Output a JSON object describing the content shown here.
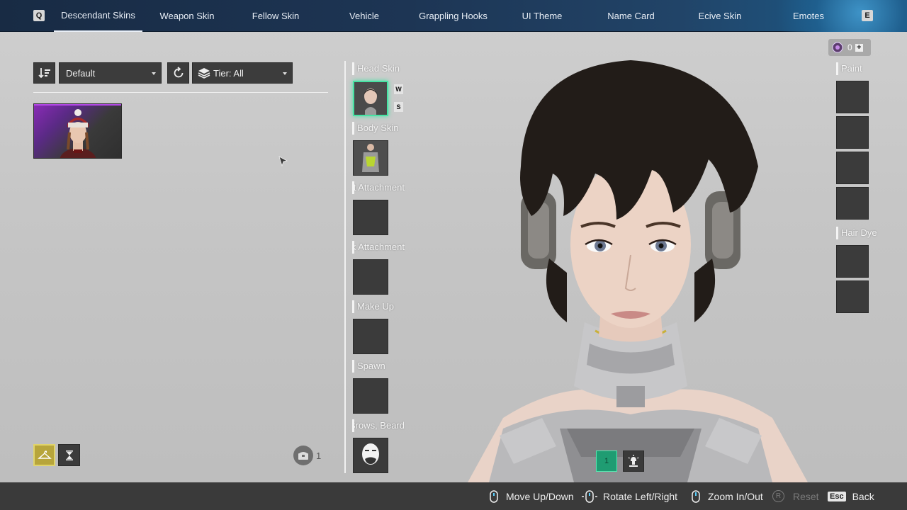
{
  "nav": {
    "left_key": "Q",
    "right_key": "E",
    "tabs": [
      {
        "label": "Descendant Skins",
        "active": true
      },
      {
        "label": "Weapon Skin"
      },
      {
        "label": "Fellow Skin"
      },
      {
        "label": "Vehicle"
      },
      {
        "label": "Grappling Hooks"
      },
      {
        "label": "UI Theme"
      },
      {
        "label": "Name Card"
      },
      {
        "label": "Ecive Skin"
      },
      {
        "label": "Emotes"
      }
    ]
  },
  "filters": {
    "sort_value": "Default",
    "tier_value": "Tier: All"
  },
  "inventory": {
    "count": "1"
  },
  "slots": {
    "head_skin": "Head Skin",
    "head_tags": [
      "W",
      "S"
    ],
    "body_skin": "Body Skin",
    "front_attachment": "Front Attachment",
    "back_attachment": "Back Attachment",
    "make_up": "Make Up",
    "spawn": "Spawn",
    "brows_beard": "Brows, Beard"
  },
  "currency": {
    "amount": "0",
    "plus": "+"
  },
  "right_slots": {
    "paint": "Paint",
    "hair_dye": "Hair Dye"
  },
  "emote_slot": "1",
  "hints": {
    "move": "Move Up/Down",
    "rotate": "Rotate Left/Right",
    "zoom": "Zoom In/Out",
    "reset_key": "R",
    "reset": "Reset",
    "esc_key": "Esc",
    "back": "Back"
  },
  "colors": {
    "accent_green": "#47e3a4",
    "purple_rarity": "#b349e6",
    "active_filter": "#b7a53b"
  }
}
